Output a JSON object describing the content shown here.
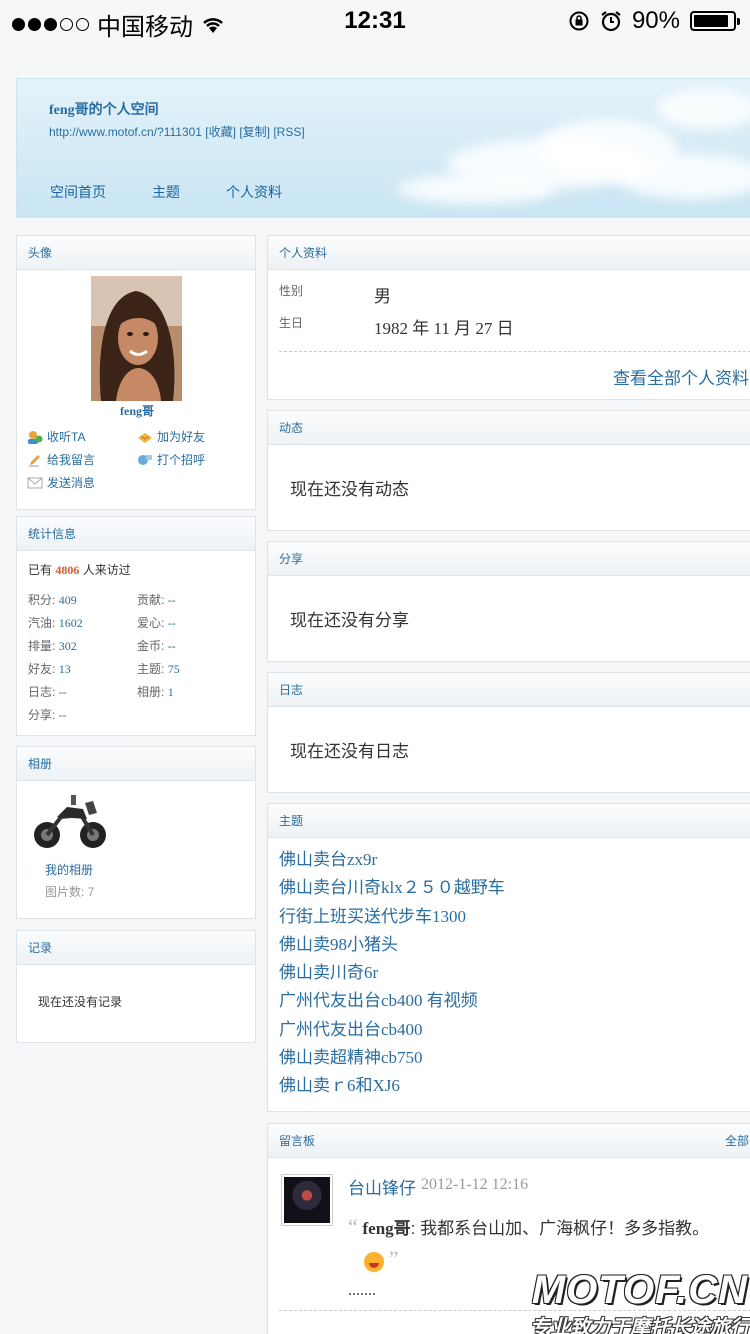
{
  "status_bar": {
    "carrier": "中国移动",
    "time": "12:31",
    "battery": "90%",
    "battery_level": 0.9
  },
  "header": {
    "title": "feng哥的个人空间",
    "url_line": "http://www.motof.cn/?111301 [收藏] [复制] [RSS]",
    "nav": [
      "空间首页",
      "主题",
      "个人资料"
    ]
  },
  "avatar_panel": {
    "title": "头像",
    "name": "feng哥",
    "actions": {
      "follow": "收听TA",
      "add_friend": "加为好友",
      "leave_message": "给我留言",
      "greet": "打个招呼",
      "send_message": "发送消息"
    }
  },
  "stats_panel": {
    "title": "统计信息",
    "visits_prefix": "已有",
    "visits": "4806",
    "visits_suffix": "人来访过",
    "items": [
      {
        "label": "积分:",
        "value": "409"
      },
      {
        "label": "贡献:",
        "value": "--"
      },
      {
        "label": "汽油:",
        "value": "1602"
      },
      {
        "label": "爱心:",
        "value": "--"
      },
      {
        "label": "排量:",
        "value": "302"
      },
      {
        "label": "金币:",
        "value": "--"
      },
      {
        "label": "好友:",
        "value": "13"
      },
      {
        "label": "主题:",
        "value": "75"
      },
      {
        "label": "日志:",
        "value": "--"
      },
      {
        "label": "相册:",
        "value": "1"
      },
      {
        "label": "分享:",
        "value": "--"
      }
    ]
  },
  "album_panel": {
    "title": "相册",
    "album_name": "我的相册",
    "photo_count": "图片数: 7"
  },
  "record_panel": {
    "title": "记录",
    "empty": "现在还没有记录"
  },
  "profile_panel": {
    "title": "个人资料",
    "gender_label": "性别",
    "gender_value": "男",
    "birthday_label": "生日",
    "birthday_value": "1982 年 11 月 27 日",
    "view_all": "查看全部个人资料"
  },
  "feed_panel": {
    "title": "动态",
    "empty": "现在还没有动态"
  },
  "share_panel": {
    "title": "分享",
    "empty": "现在还没有分享"
  },
  "blog_panel": {
    "title": "日志",
    "empty": "现在还没有日志"
  },
  "topics_panel": {
    "title": "主题",
    "items": [
      "佛山卖台zx9r",
      "佛山卖台川奇klx２５０越野车",
      "行街上班买送代步车1300",
      "佛山卖98小猪头",
      "佛山卖川奇6r",
      "广州代友出台cb400 有视频",
      "广州代友出台cb400",
      "佛山卖超精神cb750",
      "佛山卖ｒ6和XJ6"
    ]
  },
  "guestbook_panel": {
    "title": "留言板",
    "more": "全部",
    "entry": {
      "author": "台山锋仔",
      "time": "2012-1-12 12:16",
      "quote_name": "feng哥",
      "quote_text": ": 我都系台山加、广海枫仔！多多指教。",
      "ellipsis": "......."
    }
  },
  "watermark": {
    "logo": "MOTOF.CN",
    "slogan": "专业致力于摩托长途旅行"
  }
}
